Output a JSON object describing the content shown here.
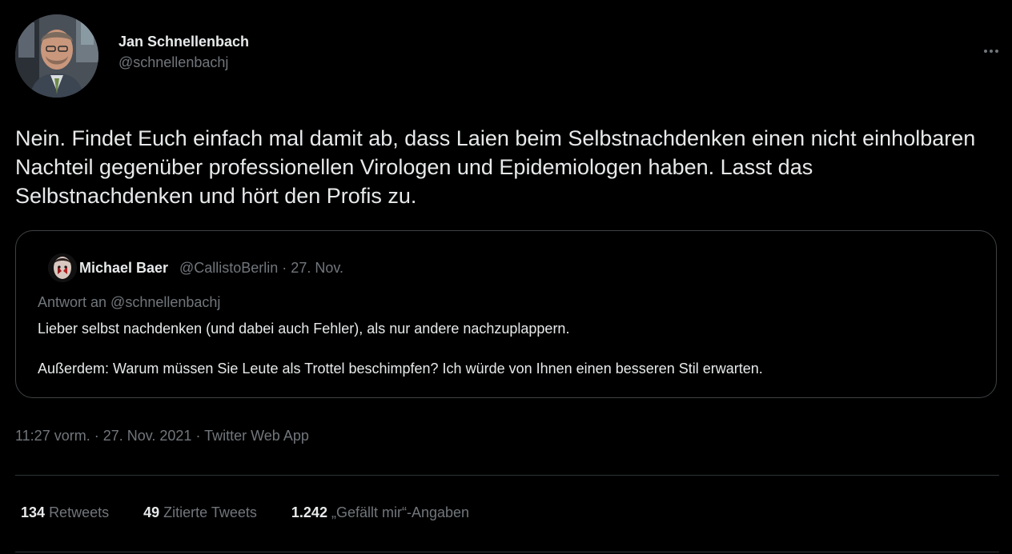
{
  "author": {
    "name": "Jan Schnellenbach",
    "handle": "@schnellenbachj"
  },
  "tweet": {
    "text": "Nein. Findet Euch einfach mal damit ab, dass Laien beim Selbstnachdenken einen nicht einholbaren Nachteil gegenüber professionellen Virologen und Epidemiologen haben. Lasst das Selbstnachdenken und hört den Profis zu."
  },
  "quoted": {
    "name": "Michael Baer",
    "meta": "@CallistoBerlin · 27. Nov.",
    "reply_to": "Antwort an @schnellenbachj",
    "paragraph_1": "Lieber selbst nachdenken (und dabei auch Fehler), als nur andere nachzuplappern.",
    "paragraph_2": "Außerdem: Warum müssen Sie Leute als Trottel beschimpfen? Ich würde von Ihnen einen besseren Stil erwarten."
  },
  "timestamp": {
    "time_date": "11:27 vorm. · 27. Nov. 2021",
    "separator": " · ",
    "source": "Twitter Web App"
  },
  "stats": {
    "retweets_count": "134",
    "retweets_label": "Retweets",
    "quotes_count": "49",
    "quotes_label": "Zitierte Tweets",
    "likes_count": "1.242",
    "likes_label": "„Gefällt mir“-Angaben"
  },
  "icons": {
    "more": "more-horizontal-icon"
  },
  "colors": {
    "background": "#000000",
    "primary_text": "#e7e9ea",
    "secondary_text": "#71767b",
    "border": "#2f3336"
  }
}
